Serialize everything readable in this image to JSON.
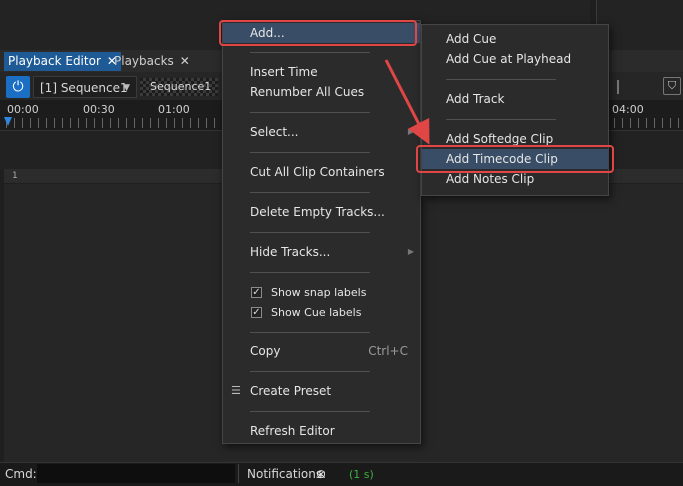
{
  "tabs": [
    {
      "label": "Playback Editor",
      "close": "✕",
      "active": true
    },
    {
      "label": "Playbacks",
      "close": "✕",
      "active": false
    }
  ],
  "toolbar": {
    "power_icon": "⏻",
    "sequence_select": "[1] Sequence1",
    "sequence_name": "Sequence1"
  },
  "ruler": {
    "labels": [
      "00:00",
      "00:30",
      "01:00",
      "04:00"
    ]
  },
  "track_row": {
    "number": "1"
  },
  "context_menu": {
    "add": "Add...",
    "insert_time": "Insert Time",
    "renumber_cues": "Renumber All Cues",
    "select": "Select...",
    "cut_containers": "Cut All Clip Containers",
    "delete_empty": "Delete Empty Tracks...",
    "hide_tracks": "Hide Tracks...",
    "show_snap_labels": "Show snap labels",
    "show_cue_labels": "Show Cue labels",
    "copy": "Copy",
    "copy_shortcut": "Ctrl+C",
    "create_preset": "Create Preset",
    "refresh": "Refresh Editor"
  },
  "submenu": {
    "add_cue": "Add Cue",
    "add_cue_playhead": "Add Cue at Playhead",
    "add_track": "Add Track",
    "add_softedge": "Add Softedge Clip",
    "add_timecode": "Add Timecode Clip",
    "add_notes": "Add Notes Clip"
  },
  "status": {
    "cmd_label": "Cmd:",
    "notifications_label": "Notifications:",
    "notifications_icon": "⊗",
    "notifications_time": "(1 s)"
  },
  "colors": {
    "accent": "#1e5b96",
    "highlight": "#394d66",
    "annotation": "#e04646",
    "status_green": "#3fae3f"
  }
}
